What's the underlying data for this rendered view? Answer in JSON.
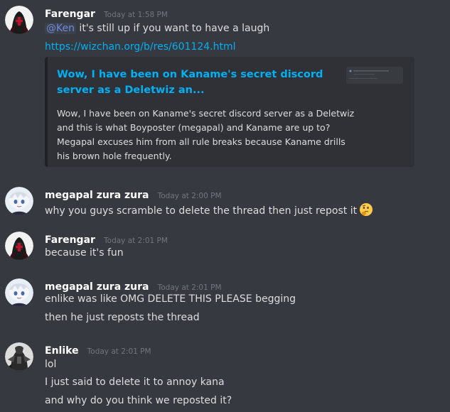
{
  "messages": [
    {
      "username": "Farengar",
      "timestamp": "Today at 1:58 PM",
      "mention": "@Ken",
      "text": " it's still up if you want to have a laugh",
      "link": "https://wizchan.org/b/res/601124.html",
      "embed": {
        "title": "Wow, I have been on Kaname's secret discord server as a Deletwiz an...",
        "description": "Wow, I have been on Kaname's secret discord server as a Deletwiz and this is what Boyposter (megapal) and Kaname are up to? Megapal excuses him from all rule breaks because Kaname drills his brown hole frequently."
      }
    },
    {
      "username": "megapal zura zura",
      "timestamp": "Today at 2:00 PM",
      "lines": [
        "why you guys scramble to delete the thread then just repost it"
      ],
      "emoji": "thinking-emoji"
    },
    {
      "username": "Farengar",
      "timestamp": "Today at 2:01 PM",
      "lines": [
        "because it's fun"
      ]
    },
    {
      "username": "megapal zura zura",
      "timestamp": "Today at 2:01 PM",
      "lines": [
        "enlike was like OMG DELETE THIS PLEASE begging",
        "then he just reposts the thread"
      ]
    },
    {
      "username": "Enlike",
      "timestamp": "Today at 2:01 PM",
      "lines": [
        "lol",
        "I just said to delete it to annoy kana",
        "and why do you think we reposted it?"
      ]
    }
  ],
  "colors": {
    "background": "#36393f",
    "username": "#ffffff",
    "text": "#dcddde",
    "timestamp": "#72767d",
    "link": "#00b0f4",
    "mention": "#7289da",
    "embed_bg": "#2f3136"
  }
}
